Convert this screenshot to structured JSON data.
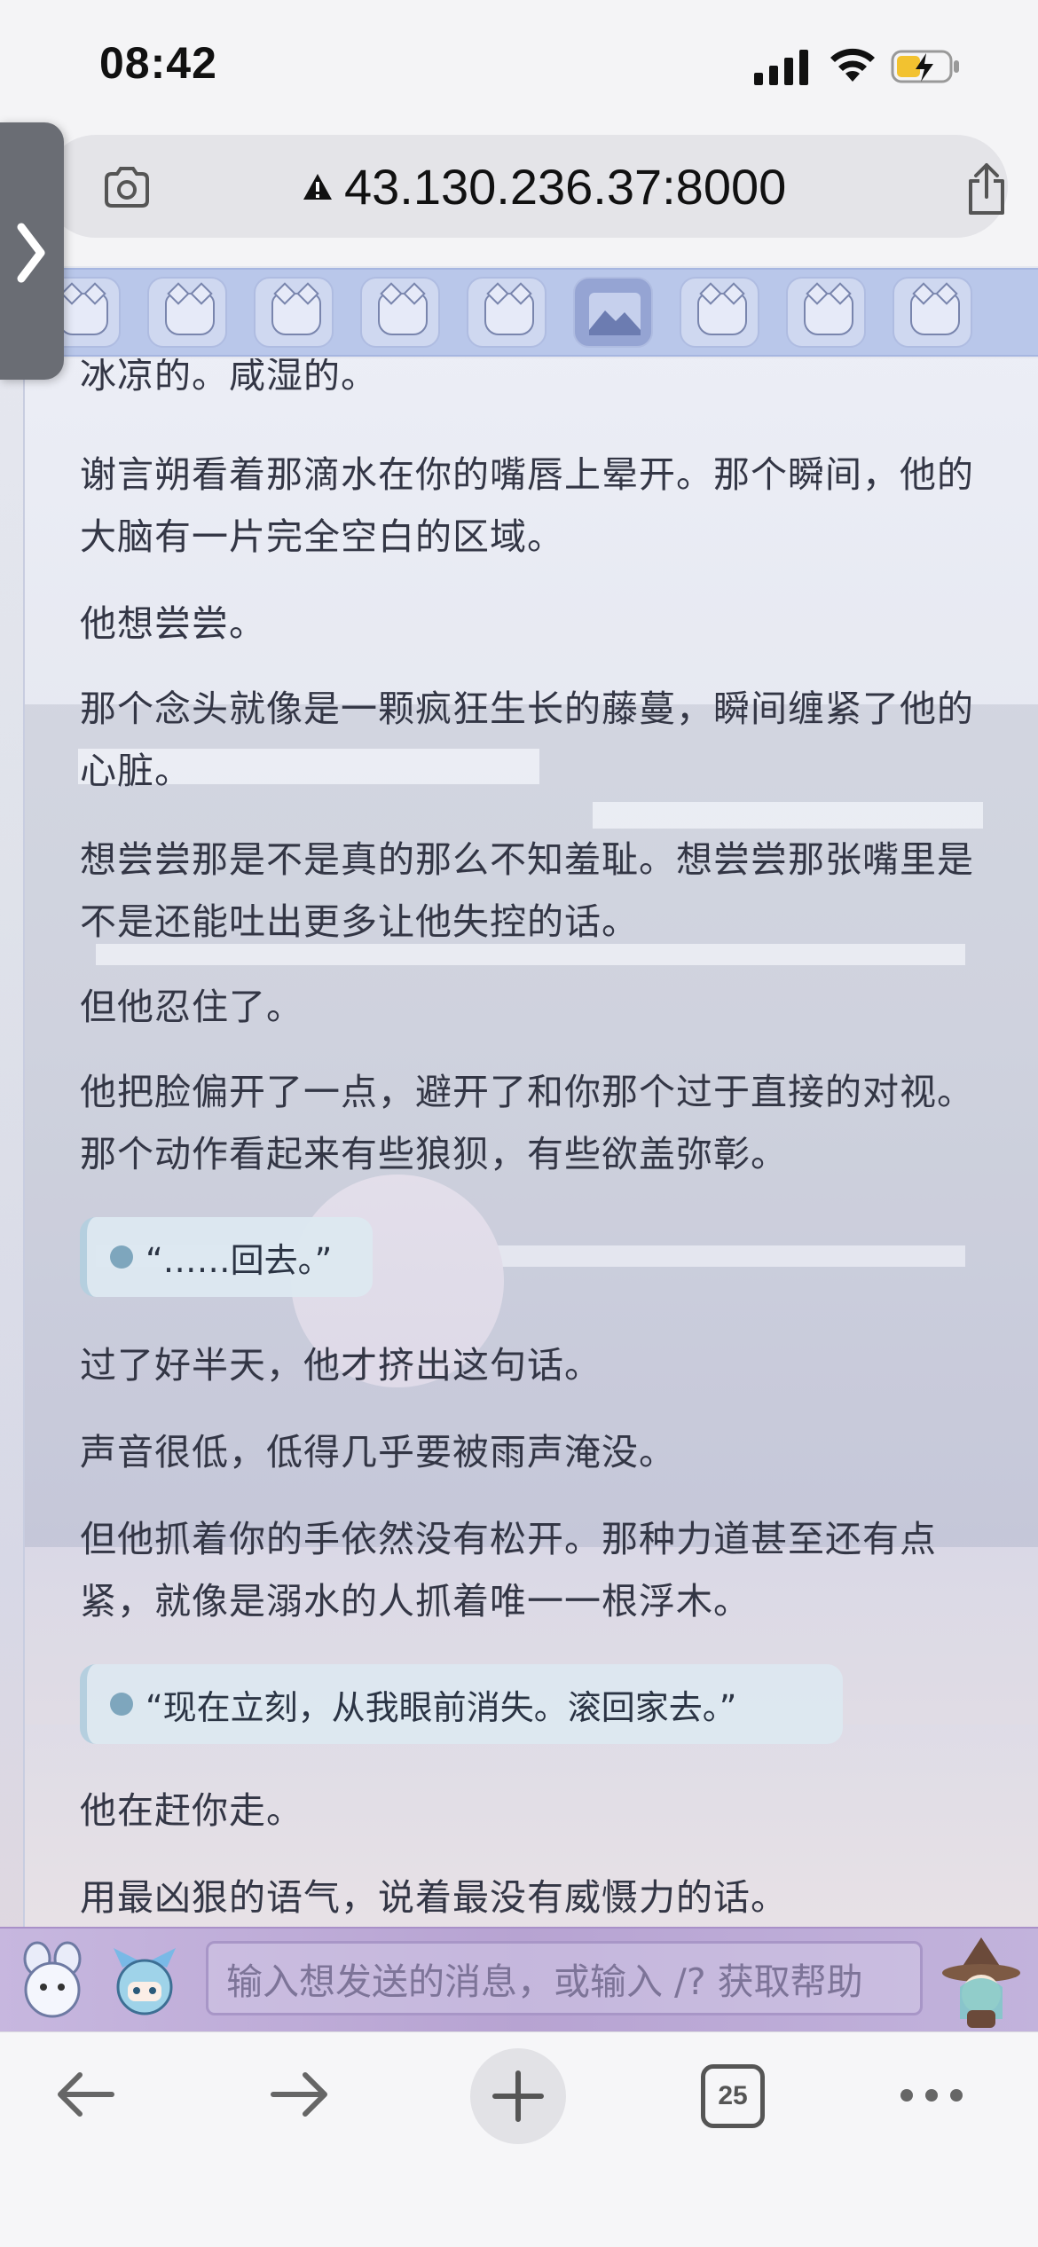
{
  "status_bar": {
    "time": "08:42"
  },
  "browser": {
    "url": "43.130.236.37:8000",
    "tab_count": "25"
  },
  "sticker_bar": {
    "stickers": [
      "sticker-1",
      "sticker-2",
      "sticker-3",
      "sticker-4",
      "sticker-5",
      "image",
      "sticker-6",
      "sticker-7",
      "sticker-8"
    ]
  },
  "story": {
    "paragraphs": [
      "冰凉的。咸湿的。",
      "谢言朔看着那滴水在你的嘴唇上晕开。那个瞬间，他的大脑有一片完全空白的区域。",
      "他想尝尝。",
      "那个念头就像是一颗疯狂生长的藤蔓，瞬间缠紧了他的心脏。",
      "想尝尝那是不是真的那么不知羞耻。想尝尝那张嘴里是不是还能吐出更多让他失控的话。",
      "但他忍住了。",
      "他把脸偏开了一点，避开了和你那个过于直接的对视。那个动作看起来有些狼狈，有些欲盖弥彰。",
      "过了好半天，他才挤出这句话。",
      "声音很低，低得几乎要被雨声淹没。",
      "但他抓着你的手依然没有松开。那种力道甚至还有点紧，就像是溺水的人抓着唯一一根浮木。",
      "他在赶你走。",
      "用最凶狠的语气，说着最没有威慑力的话。"
    ],
    "quotes": [
      "“……回去。”",
      "“现在立刻，从我眼前消失。滚回家去。”"
    ]
  },
  "composer": {
    "placeholder": "输入想发送的消息，或输入 /? 获取帮助"
  },
  "colors": {
    "accent": "#b9c7ea",
    "input_bar": "#b7a3d2",
    "quote_dot": "#7ea6bd"
  }
}
